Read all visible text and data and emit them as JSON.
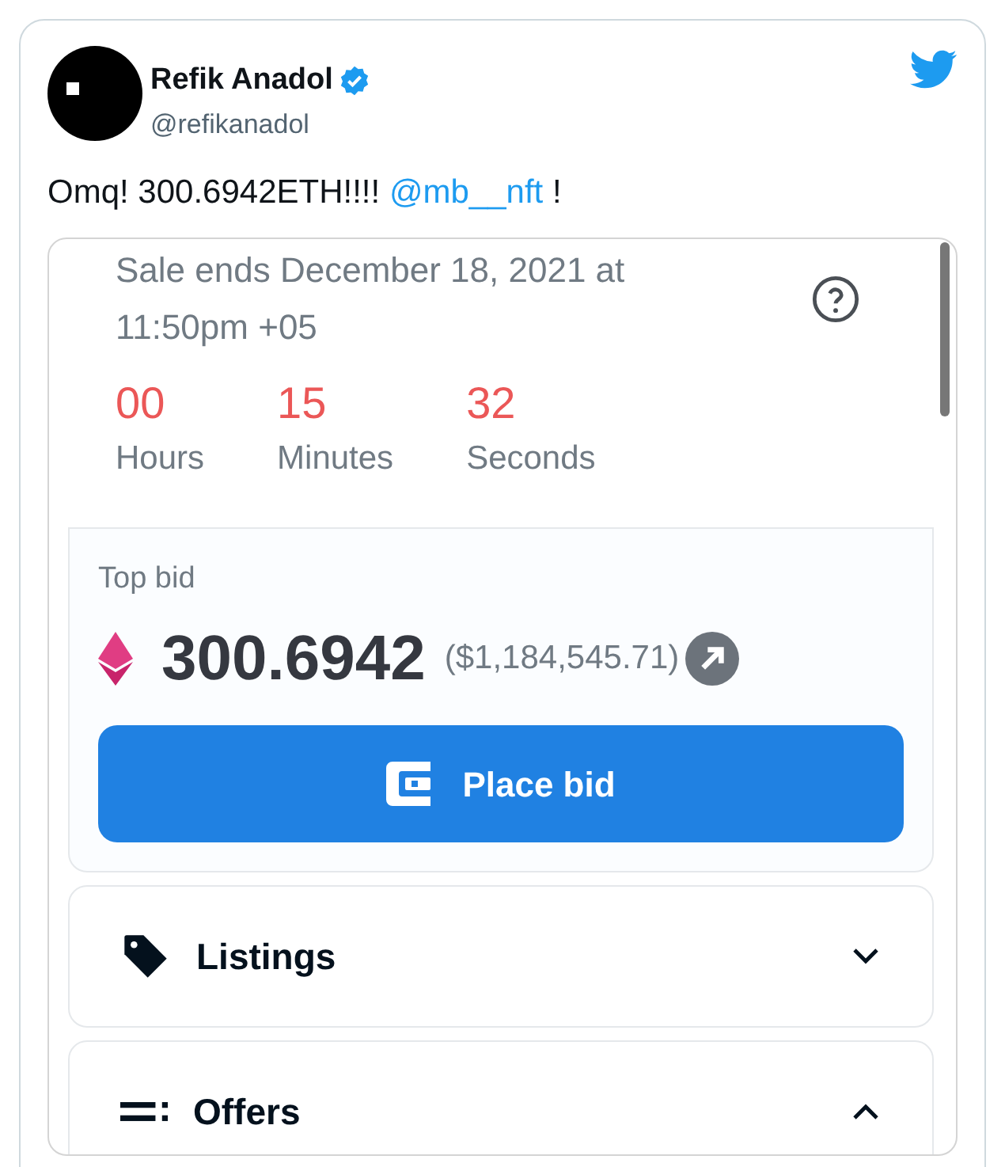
{
  "tweet": {
    "author": "Refik Anadol",
    "verified": true,
    "handle": "@refikanadol",
    "text": "Omq! 300.6942ETH!!!! ",
    "mention": "@mb__nft",
    "text_end": " !"
  },
  "embed": {
    "sale_ends": "Sale ends December 18, 2021 at 11:50pm +05",
    "countdown": [
      {
        "value": "00",
        "unit": "Hours"
      },
      {
        "value": "15",
        "unit": "Minutes"
      },
      {
        "value": "32",
        "unit": "Seconds"
      }
    ],
    "top_bid": {
      "label": "Top bid",
      "amount": "300.6942",
      "usd": "($1,184,545.71)"
    },
    "button": "Place bid",
    "sections": [
      {
        "kind": "tag",
        "label": "Listings",
        "expanded": false
      },
      {
        "kind": "list",
        "label": "Offers",
        "expanded": true
      }
    ]
  }
}
